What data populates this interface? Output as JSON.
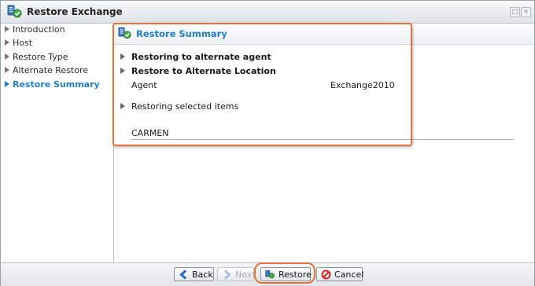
{
  "window": {
    "title": "Restore Exchange"
  },
  "sidebar": {
    "items": [
      {
        "label": "Introduction",
        "active": false
      },
      {
        "label": "Host",
        "active": false
      },
      {
        "label": "Restore Type",
        "active": false
      },
      {
        "label": "Alternate Restore",
        "active": false
      },
      {
        "label": "Restore Summary",
        "active": true
      }
    ]
  },
  "summary": {
    "title": "Restore Summary",
    "restoring_agent": "Restoring to alternate agent",
    "restore_location": "Restore to Alternate Location",
    "agent_label": "Agent",
    "agent_value": "Exchange2010",
    "selected_items": "Restoring selected items",
    "item_name": "CARMEN"
  },
  "footer": {
    "back_label": "Back",
    "next_label": "Next",
    "restore_label": "Restore",
    "cancel_label": "Cancel"
  },
  "colors": {
    "accent": "#1e7fd1",
    "highlight": "#e8703a"
  }
}
